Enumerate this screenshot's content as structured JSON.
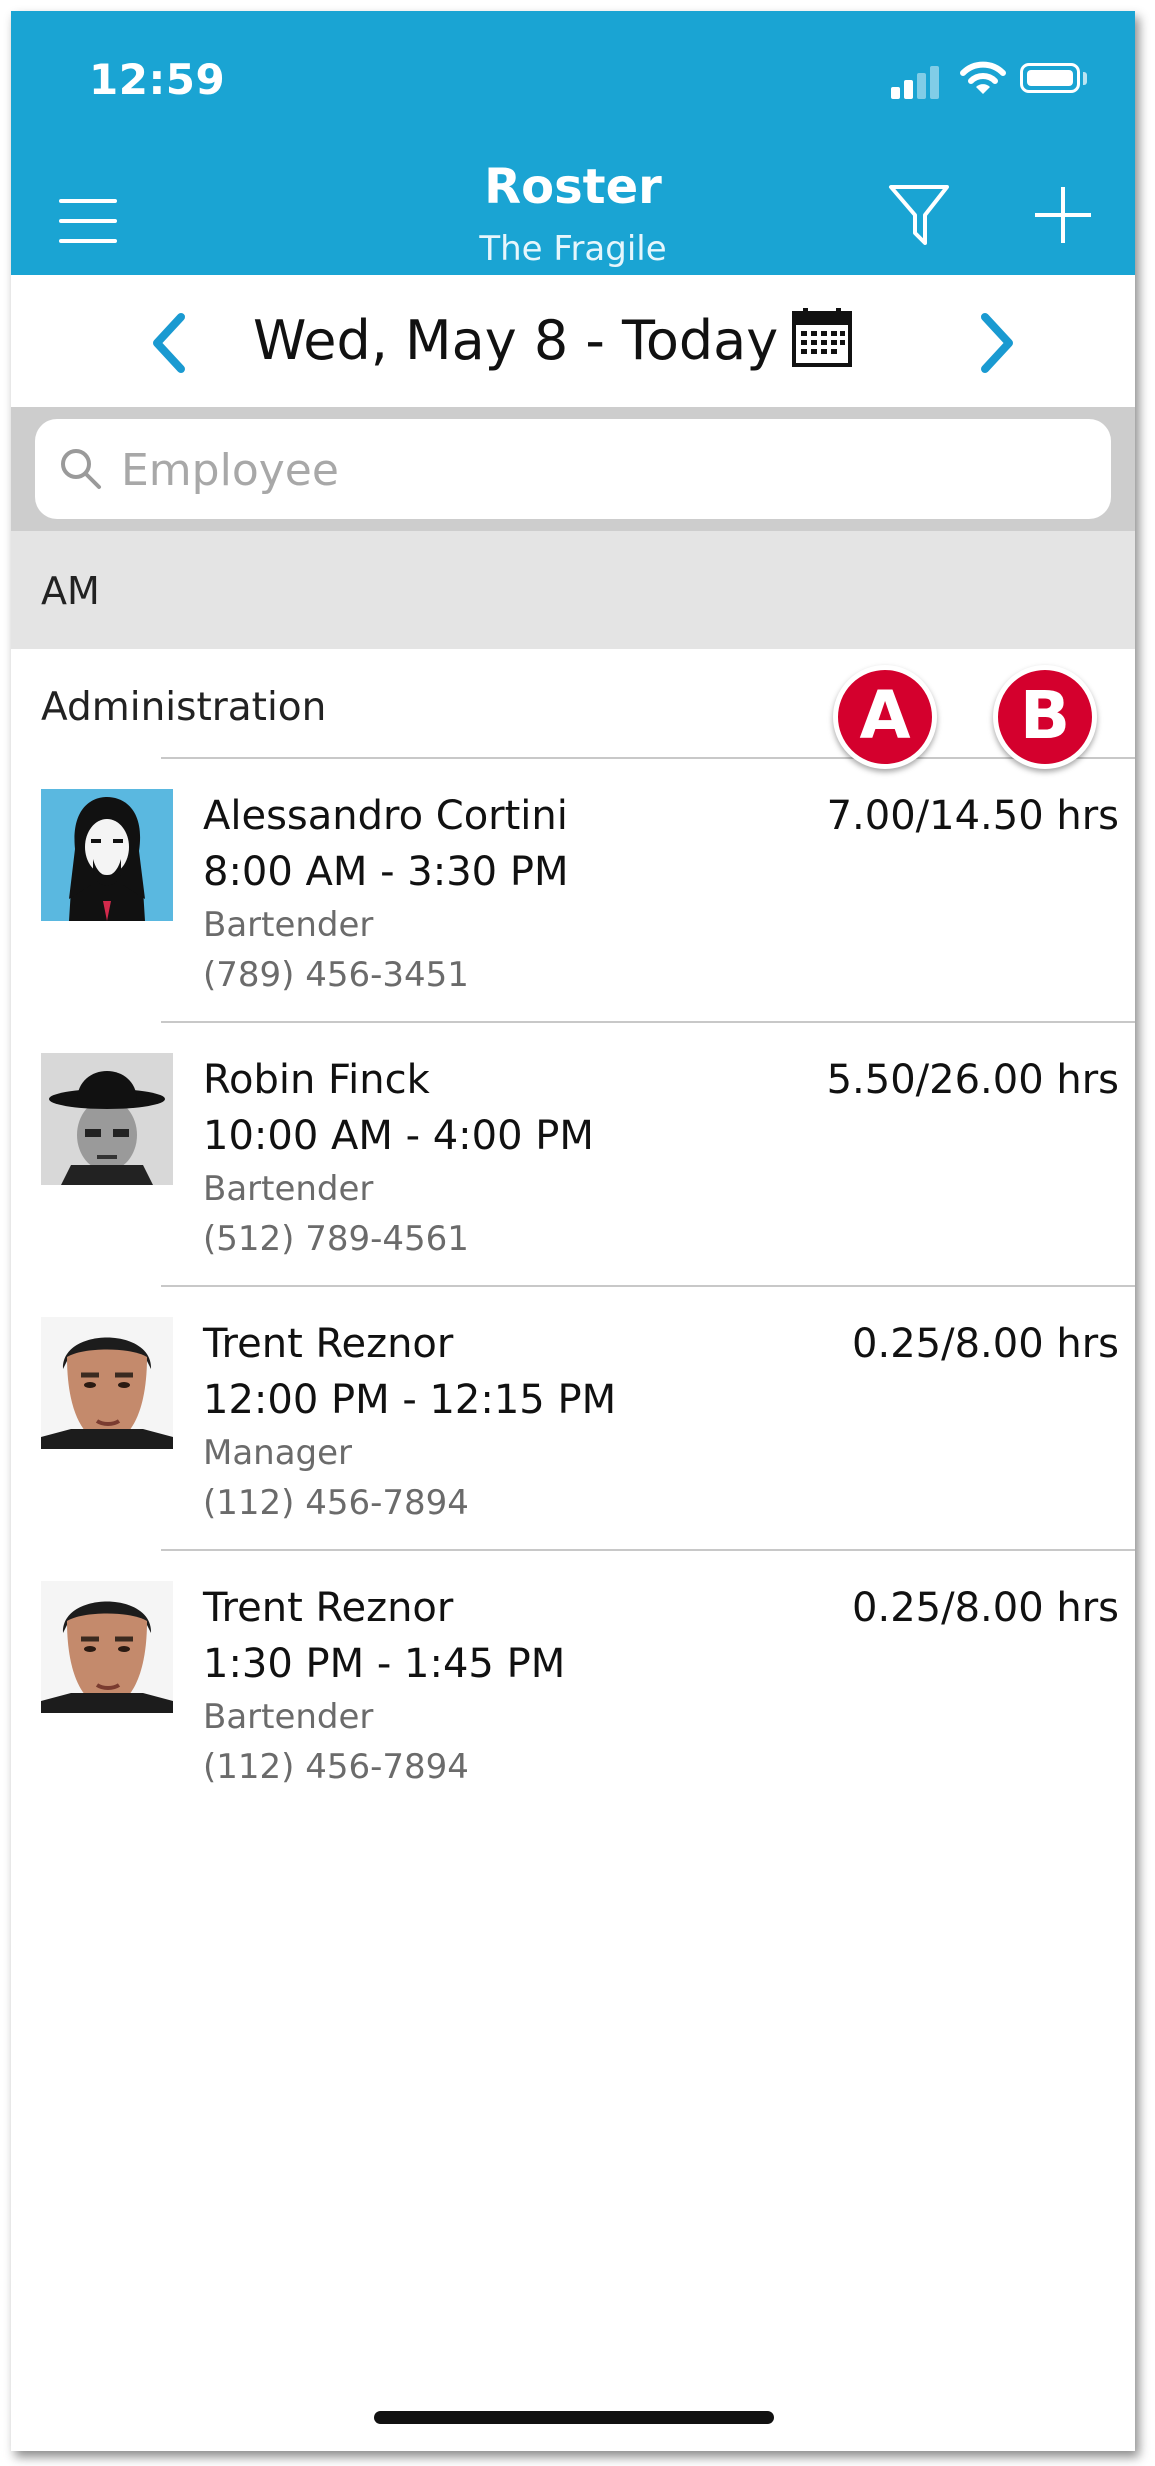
{
  "status_bar": {
    "time": "12:59"
  },
  "header": {
    "title": "Roster",
    "subtitle": "The Fragile",
    "menu_icon": "hamburger-menu-icon",
    "filter_icon": "funnel-filter-icon",
    "add_icon": "plus-icon"
  },
  "date_nav": {
    "date_label": "Wed, May 8 - Today",
    "prev_icon": "chevron-left-icon",
    "next_icon": "chevron-right-icon",
    "calendar_icon": "calendar-icon"
  },
  "search": {
    "placeholder": "Employee",
    "value": ""
  },
  "section": {
    "label": "AM"
  },
  "group": {
    "label": "Administration"
  },
  "badges": [
    "A",
    "B"
  ],
  "employees": [
    {
      "name": "Alessandro Cortini",
      "time": "8:00 AM - 3:30 PM",
      "role": "Bartender",
      "phone": "(789) 456-3451",
      "hours": "7.00/14.50 hrs"
    },
    {
      "name": "Robin Finck",
      "time": "10:00 AM - 4:00 PM",
      "role": "Bartender",
      "phone": "(512) 789-4561",
      "hours": "5.50/26.00 hrs"
    },
    {
      "name": "Trent Reznor",
      "time": "12:00 PM - 12:15 PM",
      "role": "Manager",
      "phone": "(112) 456-7894",
      "hours": "0.25/8.00 hrs"
    },
    {
      "name": "Trent Reznor",
      "time": "1:30 PM - 1:45 PM",
      "role": "Bartender",
      "phone": "(112) 456-7894",
      "hours": "0.25/8.00 hrs"
    }
  ],
  "colors": {
    "header_bg": "#1aa4d3",
    "accent": "#1a9ad1",
    "badge": "#d4002d",
    "section_bg": "#e4e4e4",
    "search_bg": "#cdcdcd"
  }
}
